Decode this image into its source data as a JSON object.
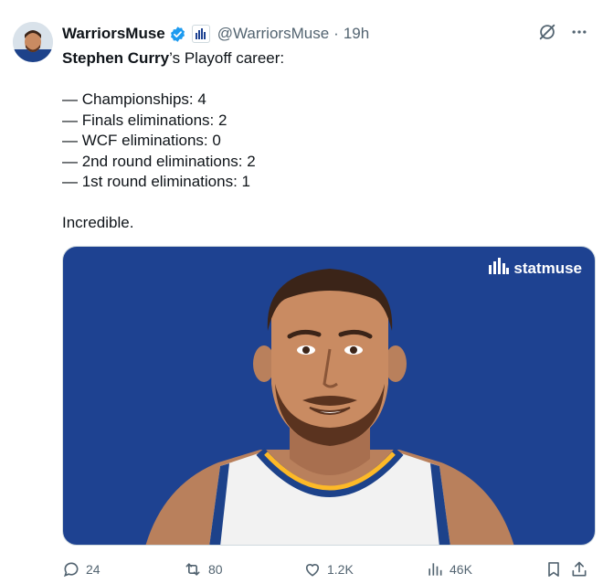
{
  "author": {
    "display_name": "WarriorsMuse",
    "handle": "@WarriorsMuse",
    "separator": "·",
    "time": "19h"
  },
  "tweet": {
    "line1_bold": "Stephen Curry",
    "line1_rest": "’s Playoff career:",
    "stats": [
      "— Championships: 4",
      "— Finals eliminations: 2",
      "— WCF eliminations: 0",
      "— 2nd round eliminations: 2",
      "— 1st round eliminations: 1"
    ],
    "closing": "Incredible."
  },
  "media": {
    "brand": "statmuse",
    "background_color": "#1e4291"
  },
  "actions": {
    "replies": "24",
    "reposts": "80",
    "likes": "1.2K",
    "views": "46K"
  },
  "icons": [
    "verified-badge-icon",
    "affiliate-badge-icon",
    "grok-icon",
    "more-icon",
    "reply-icon",
    "repost-icon",
    "like-icon",
    "views-icon",
    "bookmark-icon",
    "share-icon",
    "statmuse-logo-icon"
  ]
}
